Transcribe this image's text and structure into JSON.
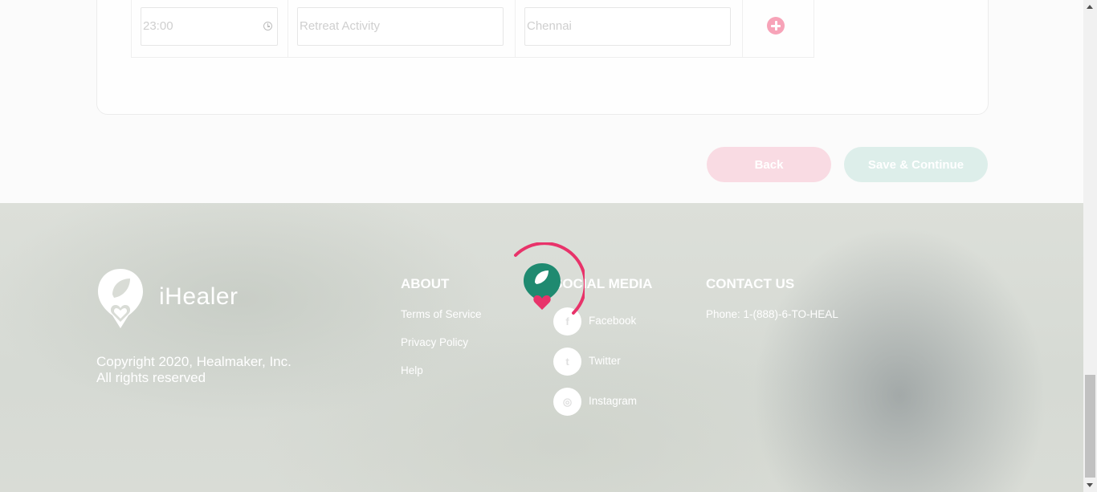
{
  "schedule_row": {
    "time_value": "23:00",
    "activity_value": "Retreat Activity",
    "location_value": "Chennai",
    "time_icon": "clock-icon",
    "add_icon": "plus-circle-icon"
  },
  "actions": {
    "back_label": "Back",
    "save_label": "Save & Continue"
  },
  "footer": {
    "brand": "iHealer",
    "copyright_line1": "Copyright 2020, Healmaker, Inc.",
    "copyright_line2": "All rights reserved",
    "about": {
      "title": "ABOUT",
      "links": [
        "Terms of Service",
        "Privacy Policy",
        "Help"
      ]
    },
    "social": {
      "title": "SOCIAL MEDIA",
      "items": [
        {
          "label": "Facebook",
          "icon": "facebook-icon",
          "glyph": "f"
        },
        {
          "label": "Twitter",
          "icon": "twitter-icon",
          "glyph": "t"
        },
        {
          "label": "Instagram",
          "icon": "instagram-icon",
          "glyph": "◎"
        }
      ]
    },
    "contact": {
      "title": "CONTACT US",
      "phone": "Phone: 1-(888)-6-TO-HEAL"
    }
  },
  "colors": {
    "accent_pink": "#e8336a",
    "accent_green": "#1f8a70",
    "back_button": "#f9dbe3",
    "save_button": "#ddeeea"
  }
}
